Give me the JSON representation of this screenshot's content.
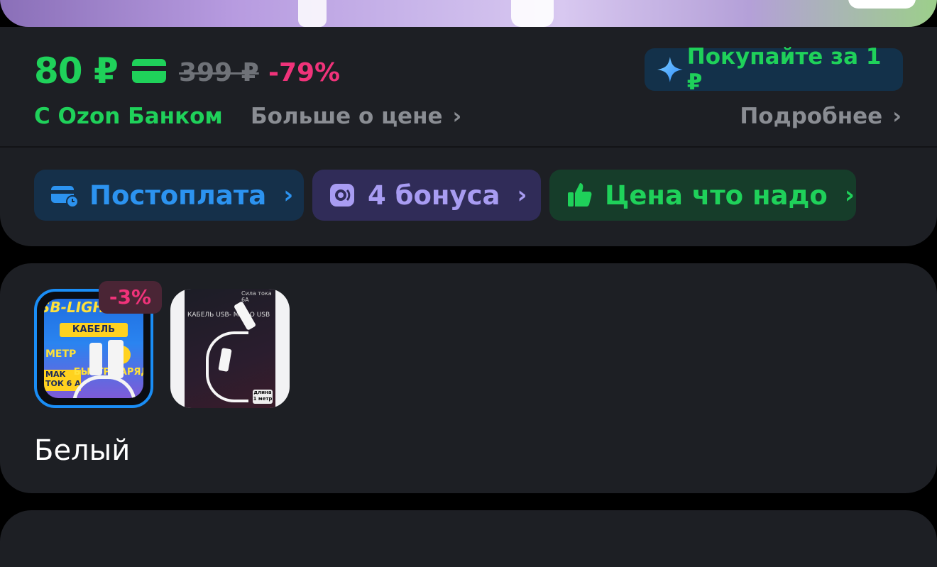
{
  "price": {
    "current": "80 ₽",
    "old": "399 ₽",
    "discount": "-79%",
    "bank_label": "С Ozon Банком",
    "more_about_price": "Больше о цене",
    "green_color": "#1fd15a",
    "discount_color": "#f0337a"
  },
  "promo": {
    "buy_label": "Покупайте за 1 ₽",
    "details_label": "Подробнее"
  },
  "chips": {
    "postpay": "Постоплата",
    "bonus": "4 бонуса",
    "good_price": "Цена что надо"
  },
  "variants": {
    "items": [
      {
        "discount_badge": "-3%",
        "title": "SB-LIGHTNI",
        "banner": "КАБЕЛЬ",
        "line1": "МЕТР",
        "line2": "МАК ТОК 6 А",
        "line3": "БЫСТР ЗАРЯД"
      },
      {
        "top_text": "Сила тока 6А",
        "label": "КАБЕЛЬ USB- MICRO USB",
        "length": "длина 1 метр"
      }
    ],
    "selected_color": "Белый"
  },
  "icons": {
    "star": "sparkle-star-icon",
    "chevron": "chevron-right-icon",
    "card": "bank-card-icon",
    "postpay": "card-clock-icon",
    "bonus": "bonus-coin-icon",
    "thumbs_up": "thumbs-up-icon"
  }
}
